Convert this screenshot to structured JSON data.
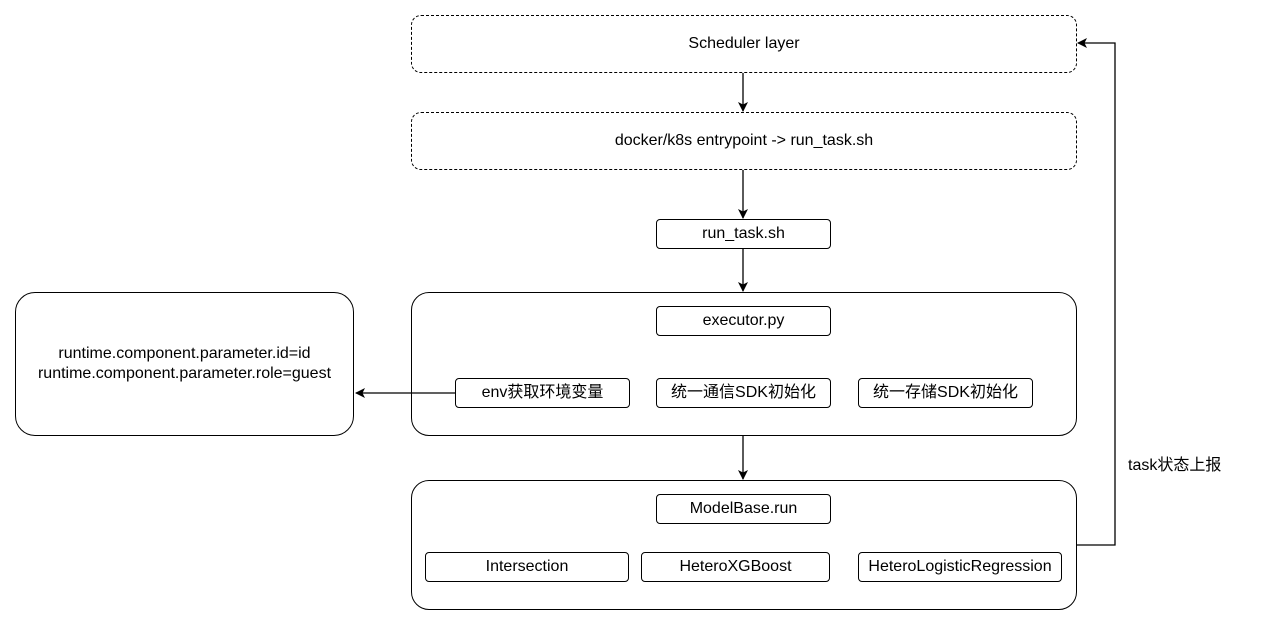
{
  "scheduler": {
    "label": "Scheduler layer"
  },
  "entrypoint": {
    "label": "docker/k8s entrypoint -> run_task.sh"
  },
  "run_task": {
    "label": "run_task.sh"
  },
  "executor": {
    "title": "executor.py",
    "steps": [
      "env获取环境变量",
      "统一通信SDK初始化",
      "统一存储SDK初始化"
    ]
  },
  "env_params": {
    "line1": "runtime.component.parameter.id=id",
    "line2": "runtime.component.parameter.role=guest"
  },
  "modelbase": {
    "title": "ModelBase.run",
    "components": [
      "Intersection",
      "HeteroXGBoost",
      "HeteroLogisticRegression"
    ]
  },
  "feedback": {
    "label": "task状态上报"
  }
}
